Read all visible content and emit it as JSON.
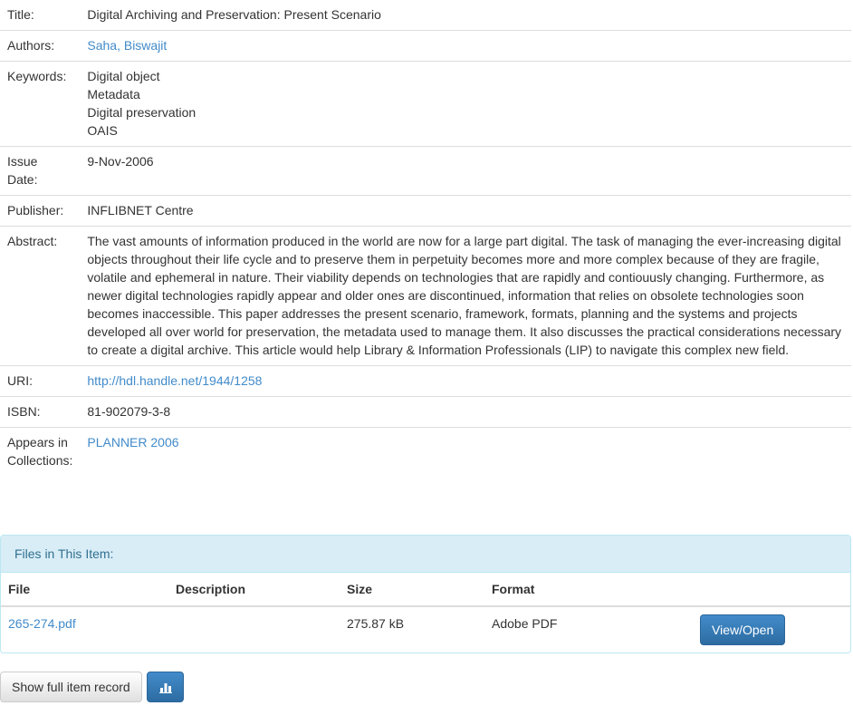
{
  "item": {
    "title": {
      "label": "Title:",
      "value": "Digital Archiving and Preservation: Present Scenario"
    },
    "authors": {
      "label": "Authors:",
      "value": "Saha, Biswajit"
    },
    "keywords": {
      "label": "Keywords:",
      "values": [
        "Digital object",
        "Metadata",
        "Digital preservation",
        "OAIS"
      ]
    },
    "issue_date": {
      "label_line1": "Issue",
      "label_line2": "Date:",
      "value": "9-Nov-2006"
    },
    "publisher": {
      "label": "Publisher:",
      "value": "INFLIBNET Centre"
    },
    "abstract": {
      "label": "Abstract:",
      "value": "The vast amounts of information produced in the world are now for a large part digital. The task of managing the ever-increasing digital objects throughout their life cycle and to preserve them in perpetuity becomes more and more complex because of they are fragile, volatile and ephemeral in nature. Their viability depends on technologies that are rapidly and contiouusly changing. Furthermore, as newer digital technologies rapidly appear and older ones are discontinued, information that relies on obsolete technologies soon becomes inaccessible. This paper addresses the present scenario, framework, formats, planning and the systems and projects developed all over world for preservation, the metadata used to manage them. It also discusses the practical considerations necessary to create a digital archive. This article would help Library & Information Professionals (LIP) to navigate this complex new field."
    },
    "uri": {
      "label": "URI:",
      "value": "http://hdl.handle.net/1944/1258"
    },
    "isbn": {
      "label": "ISBN:",
      "value": "81-902079-3-8"
    },
    "collections": {
      "label_line1": "Appears in",
      "label_line2": "Collections:",
      "value": "PLANNER 2006"
    }
  },
  "files": {
    "heading": "Files in This Item:",
    "columns": {
      "file": "File",
      "description": "Description",
      "size": "Size",
      "format": "Format"
    },
    "rows": [
      {
        "file": "265-274.pdf",
        "description": "",
        "size": "275.87 kB",
        "format": "Adobe PDF",
        "action": "View/Open"
      }
    ]
  },
  "actions": {
    "full_record": "Show full item record",
    "stats_icon": "bar-chart-icon"
  },
  "colors": {
    "link": "#428bca",
    "primary": "#428bca",
    "panel_heading_bg": "#d9edf7",
    "panel_heading_text": "#31708f"
  }
}
